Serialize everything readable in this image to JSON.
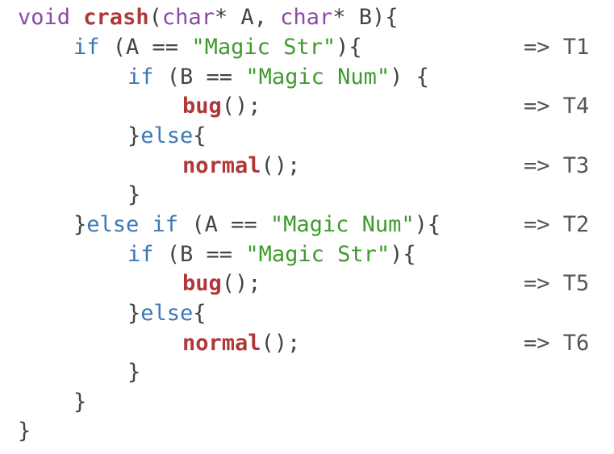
{
  "code": {
    "line1": {
      "kw_void": "void",
      "fn_crash": "crash",
      "paren_open": "(",
      "kw_char1": "char",
      "arg1": "* A, ",
      "kw_char2": "char",
      "arg2": "* B){"
    },
    "line2": {
      "kw_if": "if",
      "rest": " (A == ",
      "str": "\"Magic Str\"",
      "close": "){"
    },
    "line3": {
      "kw_if": "if",
      "rest": " (B == ",
      "str": "\"Magic Num\"",
      "close": ") {"
    },
    "line4": {
      "fn": "bug",
      "rest": "();"
    },
    "line5": {
      "brace": "}",
      "kw_else": "else",
      "open": "{"
    },
    "line6": {
      "fn": "normal",
      "rest": "();"
    },
    "line7": {
      "brace": "}"
    },
    "line8": {
      "brace": "}",
      "kw_else_if": "else if",
      "rest": " (A == ",
      "str": "\"Magic Num\"",
      "close": "){"
    },
    "line9": {
      "kw_if": "if",
      "rest": " (B == ",
      "str": "\"Magic Str\"",
      "close": "){"
    },
    "line10": {
      "fn": "bug",
      "rest": "();"
    },
    "line11": {
      "brace": "}",
      "kw_else": "else",
      "open": "{"
    },
    "line12": {
      "fn": "normal",
      "rest": "();"
    },
    "line13": {
      "brace": "}"
    },
    "line14": {
      "brace": "}"
    },
    "line15": {
      "brace": "}"
    }
  },
  "annotations": {
    "t1": "=> T1",
    "t4": "=> T4",
    "t3": "=> T3",
    "t2": "=> T2",
    "t5": "=> T5",
    "t6": "=> T6"
  },
  "colors": {
    "keyword_type": "#8a4aa6",
    "keyword_control": "#3c78b4",
    "function_name": "#b0383a",
    "string_literal": "#3f9a2e",
    "punctuation": "#555555"
  }
}
